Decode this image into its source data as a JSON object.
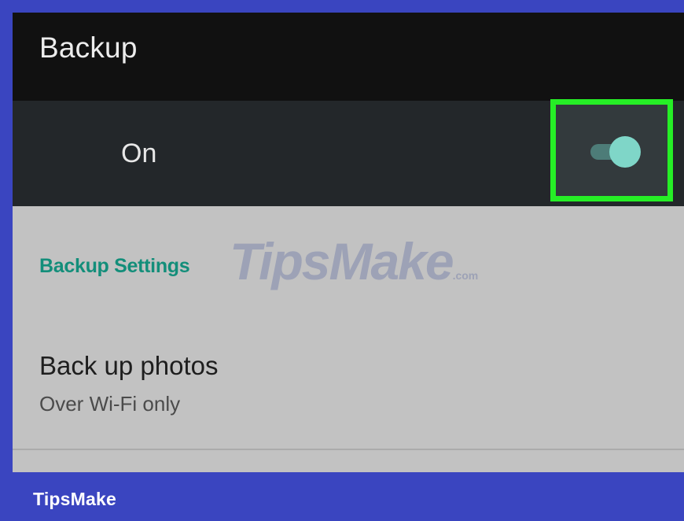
{
  "appbar": {
    "title": "Backup"
  },
  "master_switch": {
    "label": "On",
    "state": "on",
    "highlight_color": "#26ee26",
    "thumb_color": "#7fd6c8"
  },
  "section": {
    "header": "Backup Settings",
    "accent_color": "#138e7a"
  },
  "items": [
    {
      "title": "Back up photos",
      "subtitle": "Over Wi-Fi only"
    }
  ],
  "watermark": {
    "text": "TipsMake",
    "suffix": ".com"
  },
  "footer": {
    "label": "TipsMake",
    "color": "#3a45c0"
  }
}
